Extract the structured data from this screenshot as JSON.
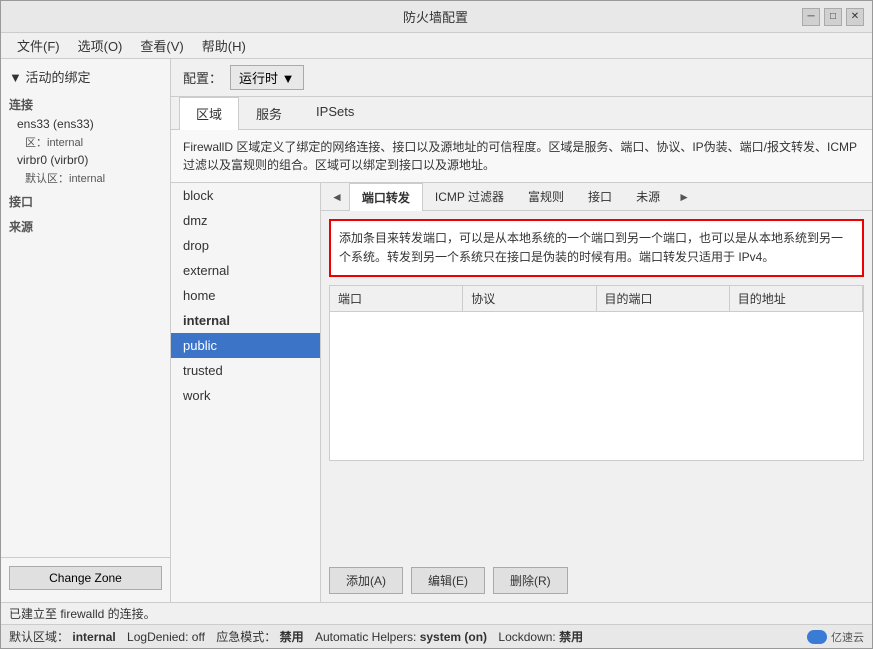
{
  "window": {
    "title": "防火墙配置",
    "minimize_label": "─",
    "maximize_label": "□",
    "close_label": "✕"
  },
  "menu": {
    "items": [
      {
        "id": "file",
        "label": "文件(F)"
      },
      {
        "id": "options",
        "label": "选项(O)"
      },
      {
        "id": "view",
        "label": "查看(V)"
      },
      {
        "id": "help",
        "label": "帮助(H)"
      }
    ]
  },
  "config_bar": {
    "label": "配置：",
    "dropdown_label": "运行时 ▼"
  },
  "tabs": [
    {
      "id": "zone",
      "label": "区域",
      "active": true
    },
    {
      "id": "service",
      "label": "服务",
      "active": false
    },
    {
      "id": "ipsets",
      "label": "IPSets",
      "active": false
    }
  ],
  "description": "FirewallD 区域定义了绑定的网络连接、接口以及源地址的可信程度。区域是服务、端口、协议、IP伪装、端口/报文转发、ICMP过滤以及富规则的组合。区域可以绑定到接口以及源地址。",
  "sidebar": {
    "active_binding_label": "▼ 活动的绑定",
    "groups": [
      {
        "label": "连接",
        "items": [
          {
            "text": "ens33 (ens33)",
            "sub": "区：internal"
          },
          {
            "text": "virbr0 (virbr0)",
            "sub": "默认区：internal"
          }
        ]
      },
      {
        "label": "接口",
        "items": []
      },
      {
        "label": "来源",
        "items": []
      }
    ],
    "change_zone_btn": "Change Zone"
  },
  "zone_list": {
    "items": [
      {
        "id": "block",
        "label": "block",
        "selected": false,
        "bold": false
      },
      {
        "id": "dmz",
        "label": "dmz",
        "selected": false,
        "bold": false
      },
      {
        "id": "drop",
        "label": "drop",
        "selected": false,
        "bold": false
      },
      {
        "id": "external",
        "label": "external",
        "selected": false,
        "bold": false
      },
      {
        "id": "home",
        "label": "home",
        "selected": false,
        "bold": false
      },
      {
        "id": "internal",
        "label": "internal",
        "selected": false,
        "bold": true
      },
      {
        "id": "public",
        "label": "public",
        "selected": true,
        "bold": false
      },
      {
        "id": "trusted",
        "label": "trusted",
        "selected": false,
        "bold": false
      },
      {
        "id": "work",
        "label": "work",
        "selected": false,
        "bold": false
      }
    ]
  },
  "sub_tabs": {
    "left_arrow": "◄",
    "right_arrow": "►",
    "items": [
      {
        "id": "port-forward",
        "label": "端口转发",
        "active": true
      },
      {
        "id": "icmp-filter",
        "label": "ICMP 过滤器",
        "active": false
      },
      {
        "id": "rich-rules",
        "label": "富规则",
        "active": false
      },
      {
        "id": "interface",
        "label": "接口",
        "active": false
      },
      {
        "id": "source",
        "label": "未源",
        "active": false
      }
    ]
  },
  "port_forward": {
    "description": "添加条目来转发端口，可以是从本地系统的一个端口到另一个端口，也可以是从本地系统到另一个系统。转发到另一个系统只在接口是伪装的时候有用。端口转发只适用于 IPv4。"
  },
  "table": {
    "headers": [
      "端口",
      "协议",
      "目的端口",
      "目的地址"
    ]
  },
  "buttons": {
    "add": "添加(A)",
    "edit": "编辑(E)",
    "delete": "删除(R)"
  },
  "status_bar": {
    "connection_status": "已建立至 firewalld 的连接。"
  },
  "status_bottom": {
    "default_zone_label": "默认区域：",
    "default_zone_value": "internal",
    "log_denied_label": "LogDenied:",
    "log_denied_value": "off",
    "emergency_label": "应急模式：",
    "emergency_value": "禁用",
    "auto_helpers_label": "Automatic Helpers:",
    "auto_helpers_value": "system (on)",
    "lockdown_label": "Lockdown:",
    "lockdown_value": "禁用",
    "brand": "亿速云"
  }
}
